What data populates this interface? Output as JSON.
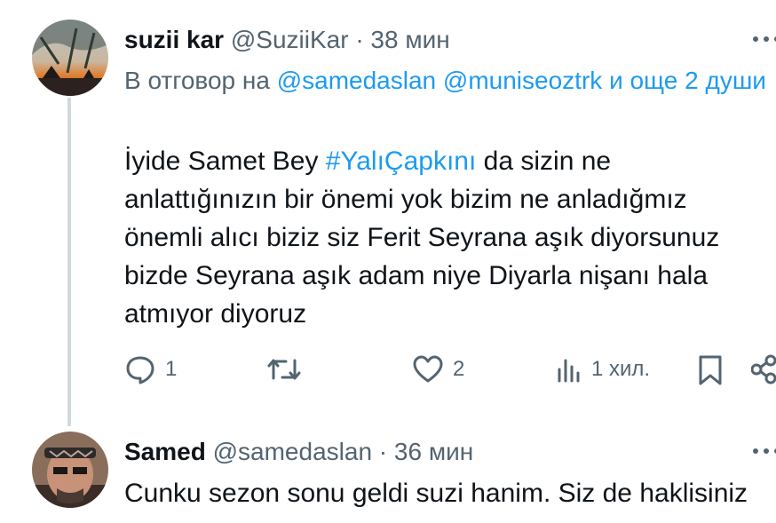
{
  "tweet1": {
    "display_name": "suzii kar",
    "handle": "@SuziiKar",
    "separator": "·",
    "time": "38 мин",
    "reply_prefix": "В отговор на",
    "reply_mention1": "@samedaslan",
    "reply_mention2": "@muniseoztrk",
    "reply_suffix": "и още 2 души",
    "text_line1_pre": "İyide Samet Bey",
    "text_hashtag": "#YalıÇapkını",
    "text_line1_post": "da sizin ne",
    "text_line2": "anlattığınızın bir önemi yok bizim ne anladığmız",
    "text_line3": "önemli alıcı biziz siz Ferit Seyrana aşık diyorsunuz",
    "text_line4": "bizde Seyrana aşık adam niye Diyarla nişanı hala",
    "text_line5": "atmıyor diyoruz",
    "replies_count": "1",
    "likes_count": "2",
    "views_count": "1 хил."
  },
  "tweet2": {
    "display_name": "Samed",
    "handle": "@samedaslan",
    "separator": "·",
    "time": "36 мин",
    "text": "Cunku sezon sonu geldi suzi hanim. Siz de haklisiniz"
  },
  "icons": {
    "reply": "reply-icon",
    "retweet": "retweet-icon",
    "like": "heart-icon",
    "views": "views-icon",
    "bookmark": "bookmark-icon",
    "share": "share-icon",
    "more": "more-icon"
  },
  "colors": {
    "text": "#0f1419",
    "muted": "#536471",
    "link": "#1d9bf0",
    "thread_line": "#cfd9de"
  }
}
